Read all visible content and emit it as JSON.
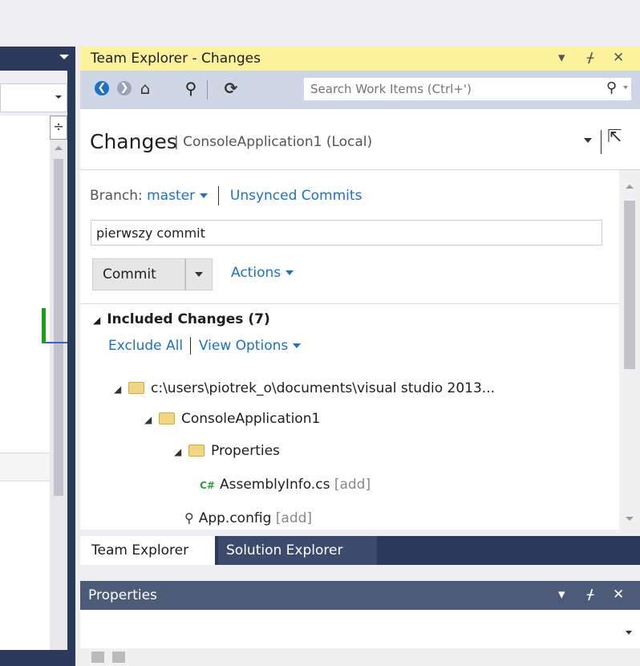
{
  "left_panel": {
    "split_glyph": "÷"
  },
  "team_explorer": {
    "title": "Team Explorer - Changes",
    "title_controls": {
      "dropdown": "▾",
      "pin": "ᚋ",
      "close": "✕"
    },
    "toolbar": {
      "back_icon": "❮",
      "forward_icon": "❯",
      "home_icon": "⌂",
      "connect_icon": "⚲",
      "refresh_icon": "⟳",
      "search_placeholder": "Search Work Items (Ctrl+')",
      "search_icon": "⚲"
    },
    "header": {
      "title": "Changes",
      "subtitle": "| ConsoleApplication1 (Local)",
      "popout_icon": "⇱"
    },
    "branch_label": "Branch:",
    "branch_name": "master",
    "unsynced_commits": "Unsynced Commits",
    "commit_message": "pierwszy commit",
    "commit_button": "Commit",
    "actions_link": "Actions",
    "included_changes": {
      "toggle": "◢",
      "title": "Included Changes (7)",
      "exclude_all": "Exclude All",
      "view_options": "View Options"
    },
    "tree": [
      {
        "toggle": "◢",
        "label": "c:\\users\\piotrek_o\\documents\\visual studio 2013..."
      },
      {
        "toggle": "◢",
        "label": "ConsoleApplication1"
      },
      {
        "toggle": "◢",
        "label": "Properties"
      },
      {
        "icon": "C#",
        "label": "AssemblyInfo.cs",
        "status": "[add]"
      },
      {
        "icon": "⚲",
        "label": "App.config",
        "status": "[add]"
      }
    ]
  },
  "tabs": {
    "team_explorer": "Team Explorer",
    "solution_explorer": "Solution Explorer"
  },
  "properties": {
    "title": "Properties",
    "controls": {
      "dropdown": "▾",
      "pin": "ᚋ",
      "close": "✕"
    }
  },
  "colors": {
    "title_highlight": "#fff29d",
    "link": "#1e70c7",
    "frame": "#2b3a5a"
  }
}
